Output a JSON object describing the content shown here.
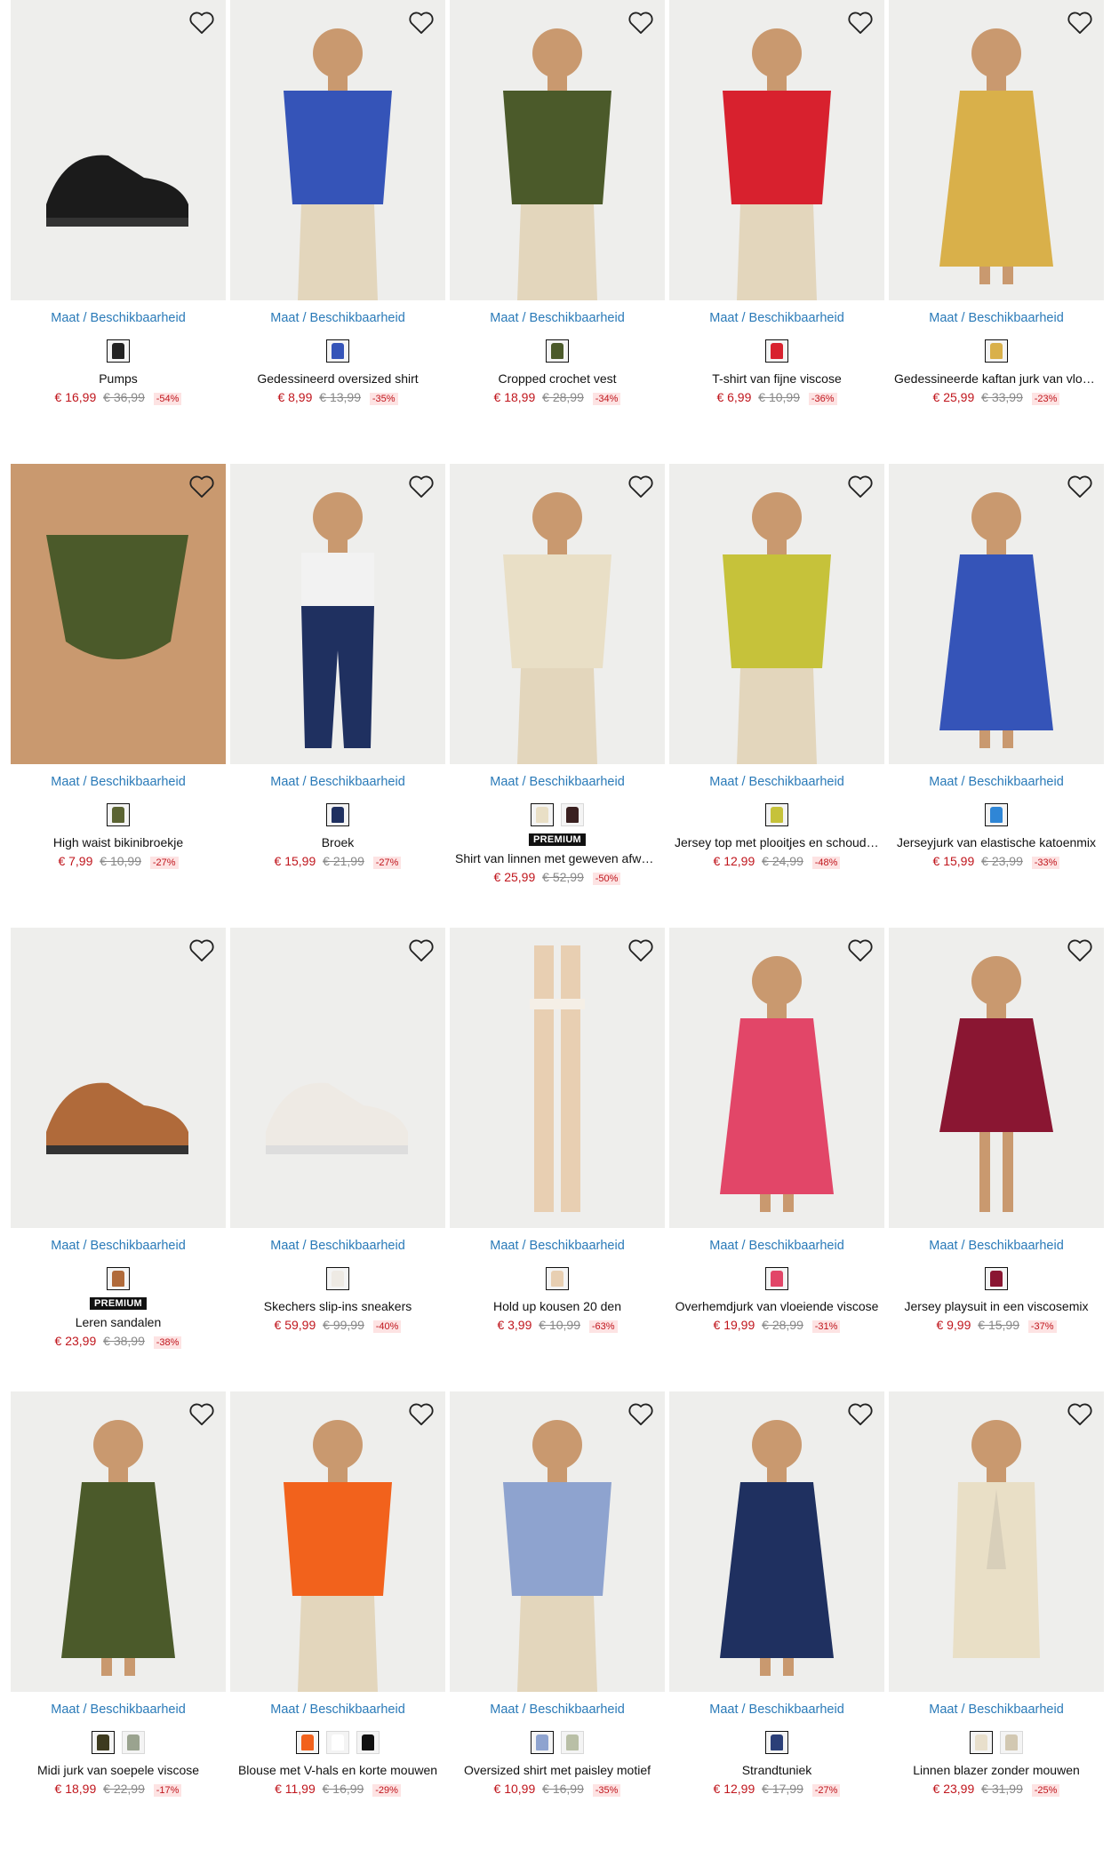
{
  "availability_label": "Maat / Beschikbaarheid",
  "premium_label": "PREMIUM",
  "colors": {
    "price_red": "#c0161d",
    "link_blue": "#2a7ab8",
    "badge_bg": "#111111"
  },
  "products": [
    {
      "name": "Pumps",
      "price": "€ 16,99",
      "old_price": "€ 36,99",
      "discount": "-54%",
      "premium": false,
      "img": "shoe-black",
      "swatches": [
        "#222222"
      ]
    },
    {
      "name": "Gedessineerd oversized shirt",
      "price": "€ 8,99",
      "old_price": "€ 13,99",
      "discount": "-35%",
      "premium": false,
      "img": "top-blue",
      "swatches": [
        "#3554b8"
      ]
    },
    {
      "name": "Cropped crochet vest",
      "price": "€ 18,99",
      "old_price": "€ 28,99",
      "discount": "-34%",
      "premium": false,
      "img": "top-olive",
      "swatches": [
        "#4b5a2a"
      ]
    },
    {
      "name": "T-shirt van fijne viscose",
      "price": "€ 6,99",
      "old_price": "€ 10,99",
      "discount": "-36%",
      "premium": false,
      "img": "top-red",
      "swatches": [
        "#d8212e"
      ]
    },
    {
      "name": "Gedessineerde kaftan jurk van vloeiende viscose",
      "price": "€ 25,99",
      "old_price": "€ 33,99",
      "discount": "-23%",
      "premium": false,
      "img": "dress-yellow",
      "swatches": [
        "#d9b04a"
      ]
    },
    {
      "name": "High waist bikinibroekje",
      "price": "€ 7,99",
      "old_price": "€ 10,99",
      "discount": "-27%",
      "premium": false,
      "img": "bikini-olive",
      "swatches": [
        "#5b6433"
      ]
    },
    {
      "name": "Broek",
      "price": "€ 15,99",
      "old_price": "€ 21,99",
      "discount": "-27%",
      "premium": false,
      "img": "pants-navy",
      "swatches": [
        "#1f3060"
      ]
    },
    {
      "name": "Shirt van linnen met geweven afwerking",
      "price": "€ 25,99",
      "old_price": "€ 52,99",
      "discount": "-50%",
      "premium": true,
      "img": "top-cream",
      "swatches": [
        "#e9dfc6",
        "#3a2020"
      ]
    },
    {
      "name": "Jersey top met plooitjes en schoudervulling",
      "price": "€ 12,99",
      "old_price": "€ 24,99",
      "discount": "-48%",
      "premium": false,
      "img": "top-zebra",
      "swatches": [
        "#c6c23a"
      ]
    },
    {
      "name": "Jerseyjurk van elastische katoenmix",
      "price": "€ 15,99",
      "old_price": "€ 23,99",
      "discount": "-33%",
      "premium": false,
      "img": "dress-blue",
      "swatches": [
        "#2f86d6"
      ]
    },
    {
      "name": "Leren sandalen",
      "price": "€ 23,99",
      "old_price": "€ 38,99",
      "discount": "-38%",
      "premium": true,
      "img": "sandal-brown",
      "swatches": [
        "#b06a3a"
      ]
    },
    {
      "name": "Skechers slip-ins sneakers",
      "price": "€ 59,99",
      "old_price": "€ 99,99",
      "discount": "-40%",
      "premium": false,
      "img": "sneaker-white",
      "swatches": [
        "#eeeae4"
      ]
    },
    {
      "name": "Hold up kousen 20 den",
      "price": "€ 3,99",
      "old_price": "€ 10,99",
      "discount": "-63%",
      "premium": false,
      "img": "stocking-nude",
      "swatches": [
        "#e8cfb2"
      ]
    },
    {
      "name": "Overhemdjurk van vloeiende viscose",
      "price": "€ 19,99",
      "old_price": "€ 28,99",
      "discount": "-31%",
      "premium": false,
      "img": "dress-pink",
      "swatches": [
        "#e24668"
      ]
    },
    {
      "name": "Jersey playsuit in een viscosemix",
      "price": "€ 9,99",
      "old_price": "€ 15,99",
      "discount": "-37%",
      "premium": false,
      "img": "playsuit-wine",
      "swatches": [
        "#8a1632"
      ]
    },
    {
      "name": "Midi jurk van soepele viscose",
      "price": "€ 18,99",
      "old_price": "€ 22,99",
      "discount": "-17%",
      "premium": false,
      "img": "dress-olive",
      "swatches": [
        "#3d3a1e",
        "#9aa38f"
      ]
    },
    {
      "name": "Blouse met V-hals en korte mouwen",
      "price": "€ 11,99",
      "old_price": "€ 16,99",
      "discount": "-29%",
      "premium": false,
      "img": "top-orange",
      "swatches": [
        "#f2621c",
        "#ffffff",
        "#111111"
      ]
    },
    {
      "name": "Oversized shirt met paisley motief",
      "price": "€ 10,99",
      "old_price": "€ 16,99",
      "discount": "-35%",
      "premium": false,
      "img": "shirt-paisley",
      "swatches": [
        "#8ea3cf",
        "#b9bfa6"
      ]
    },
    {
      "name": "Strandtuniek",
      "price": "€ 12,99",
      "old_price": "€ 17,99",
      "discount": "-27%",
      "premium": false,
      "img": "tunic-navy",
      "swatches": [
        "#2b3f78"
      ]
    },
    {
      "name": "Linnen blazer zonder mouwen",
      "price": "€ 23,99",
      "old_price": "€ 31,99",
      "discount": "-25%",
      "premium": false,
      "img": "blazer-cream",
      "swatches": [
        "#e8dfcc",
        "#d2c8b2"
      ]
    }
  ]
}
